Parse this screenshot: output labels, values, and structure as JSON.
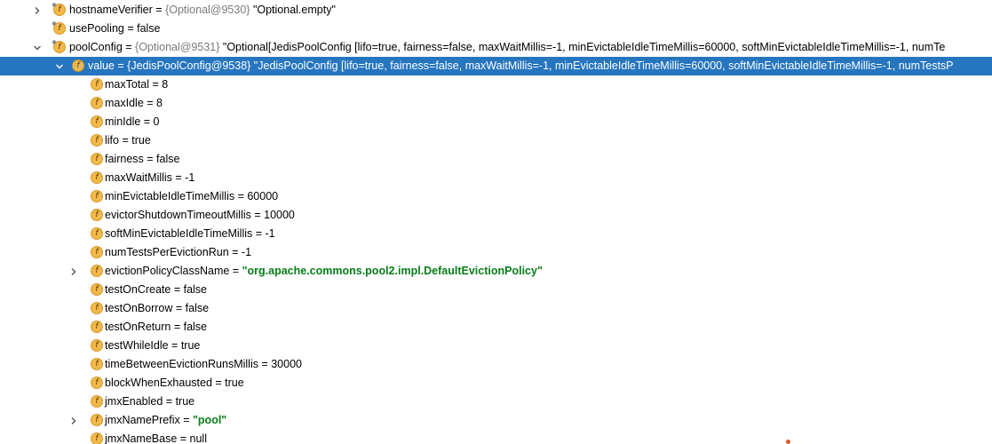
{
  "tree": {
    "rows": [
      {
        "indent": 0,
        "arrow": "right",
        "icon": "field-pinned-icon",
        "name": "hostnameVerifier",
        "eq": " = ",
        "meta": "{Optional@9530}",
        "value": " \"Optional.empty\"",
        "vtype": "plain",
        "selected": false
      },
      {
        "indent": 0,
        "arrow": "none",
        "icon": "field-pinned-icon",
        "name": "usePooling",
        "eq": " = ",
        "meta": "",
        "value": "false",
        "vtype": "plain",
        "selected": false
      },
      {
        "indent": 0,
        "arrow": "down",
        "icon": "field-pinned-icon",
        "name": "poolConfig",
        "eq": " = ",
        "meta": "{Optional@9531}",
        "value": " \"Optional[JedisPoolConfig [lifo=true, fairness=false, maxWaitMillis=-1, minEvictableIdleTimeMillis=60000, softMinEvictableIdleTimeMillis=-1, numTe",
        "vtype": "plain",
        "selected": false
      },
      {
        "indent": 1,
        "arrow": "down",
        "icon": "field-icon",
        "name": "value",
        "eq": " = ",
        "meta": "{JedisPoolConfig@9538}",
        "value": " \"JedisPoolConfig [lifo=true, fairness=false, maxWaitMillis=-1, minEvictableIdleTimeMillis=60000, softMinEvictableIdleTimeMillis=-1, numTestsP",
        "vtype": "plain",
        "selected": true
      },
      {
        "indent": 2,
        "arrow": "none",
        "icon": "field-icon",
        "name": "maxTotal",
        "eq": " = ",
        "meta": "",
        "value": "8",
        "vtype": "plain",
        "selected": false
      },
      {
        "indent": 2,
        "arrow": "none",
        "icon": "field-icon",
        "name": "maxIdle",
        "eq": " = ",
        "meta": "",
        "value": "8",
        "vtype": "plain",
        "selected": false
      },
      {
        "indent": 2,
        "arrow": "none",
        "icon": "field-icon",
        "name": "minIdle",
        "eq": " = ",
        "meta": "",
        "value": "0",
        "vtype": "plain",
        "selected": false
      },
      {
        "indent": 2,
        "arrow": "none",
        "icon": "field-icon",
        "name": "lifo",
        "eq": " = ",
        "meta": "",
        "value": "true",
        "vtype": "plain",
        "selected": false
      },
      {
        "indent": 2,
        "arrow": "none",
        "icon": "field-icon",
        "name": "fairness",
        "eq": " = ",
        "meta": "",
        "value": "false",
        "vtype": "plain",
        "selected": false
      },
      {
        "indent": 2,
        "arrow": "none",
        "icon": "field-icon",
        "name": "maxWaitMillis",
        "eq": " = ",
        "meta": "",
        "value": "-1",
        "vtype": "plain",
        "selected": false
      },
      {
        "indent": 2,
        "arrow": "none",
        "icon": "field-icon",
        "name": "minEvictableIdleTimeMillis",
        "eq": " = ",
        "meta": "",
        "value": "60000",
        "vtype": "plain",
        "selected": false
      },
      {
        "indent": 2,
        "arrow": "none",
        "icon": "field-icon",
        "name": "evictorShutdownTimeoutMillis",
        "eq": " = ",
        "meta": "",
        "value": "10000",
        "vtype": "plain",
        "selected": false
      },
      {
        "indent": 2,
        "arrow": "none",
        "icon": "field-icon",
        "name": "softMinEvictableIdleTimeMillis",
        "eq": " = ",
        "meta": "",
        "value": "-1",
        "vtype": "plain",
        "selected": false
      },
      {
        "indent": 2,
        "arrow": "none",
        "icon": "field-icon",
        "name": "numTestsPerEvictionRun",
        "eq": " = ",
        "meta": "",
        "value": "-1",
        "vtype": "plain",
        "selected": false
      },
      {
        "indent": 2,
        "arrow": "right",
        "icon": "field-icon",
        "name": "evictionPolicyClassName",
        "eq": " = ",
        "meta": "",
        "value": "\"org.apache.commons.pool2.impl.DefaultEvictionPolicy\"",
        "vtype": "string",
        "selected": false
      },
      {
        "indent": 2,
        "arrow": "none",
        "icon": "field-icon",
        "name": "testOnCreate",
        "eq": " = ",
        "meta": "",
        "value": "false",
        "vtype": "plain",
        "selected": false
      },
      {
        "indent": 2,
        "arrow": "none",
        "icon": "field-icon",
        "name": "testOnBorrow",
        "eq": " = ",
        "meta": "",
        "value": "false",
        "vtype": "plain",
        "selected": false
      },
      {
        "indent": 2,
        "arrow": "none",
        "icon": "field-icon",
        "name": "testOnReturn",
        "eq": " = ",
        "meta": "",
        "value": "false",
        "vtype": "plain",
        "selected": false
      },
      {
        "indent": 2,
        "arrow": "none",
        "icon": "field-icon",
        "name": "testWhileIdle",
        "eq": " = ",
        "meta": "",
        "value": "true",
        "vtype": "plain",
        "selected": false
      },
      {
        "indent": 2,
        "arrow": "none",
        "icon": "field-icon",
        "name": "timeBetweenEvictionRunsMillis",
        "eq": " = ",
        "meta": "",
        "value": "30000",
        "vtype": "plain",
        "selected": false
      },
      {
        "indent": 2,
        "arrow": "none",
        "icon": "field-icon",
        "name": "blockWhenExhausted",
        "eq": " = ",
        "meta": "",
        "value": "true",
        "vtype": "plain",
        "selected": false
      },
      {
        "indent": 2,
        "arrow": "none",
        "icon": "field-icon",
        "name": "jmxEnabled",
        "eq": " = ",
        "meta": "",
        "value": "true",
        "vtype": "plain",
        "selected": false
      },
      {
        "indent": 2,
        "arrow": "right",
        "icon": "field-icon",
        "name": "jmxNamePrefix",
        "eq": " = ",
        "meta": "",
        "value": "\"pool\"",
        "vtype": "string",
        "selected": false
      },
      {
        "indent": 2,
        "arrow": "none",
        "icon": "field-icon",
        "name": "jmxNameBase",
        "eq": " = ",
        "meta": "",
        "value": "null",
        "vtype": "plain",
        "selected": false
      }
    ]
  },
  "icon_letter": "f",
  "colors": {
    "selection": "#2675bf",
    "string_value": "#067d17",
    "meta_text": "#7a7a7a",
    "field_icon": "#f1b84a"
  }
}
